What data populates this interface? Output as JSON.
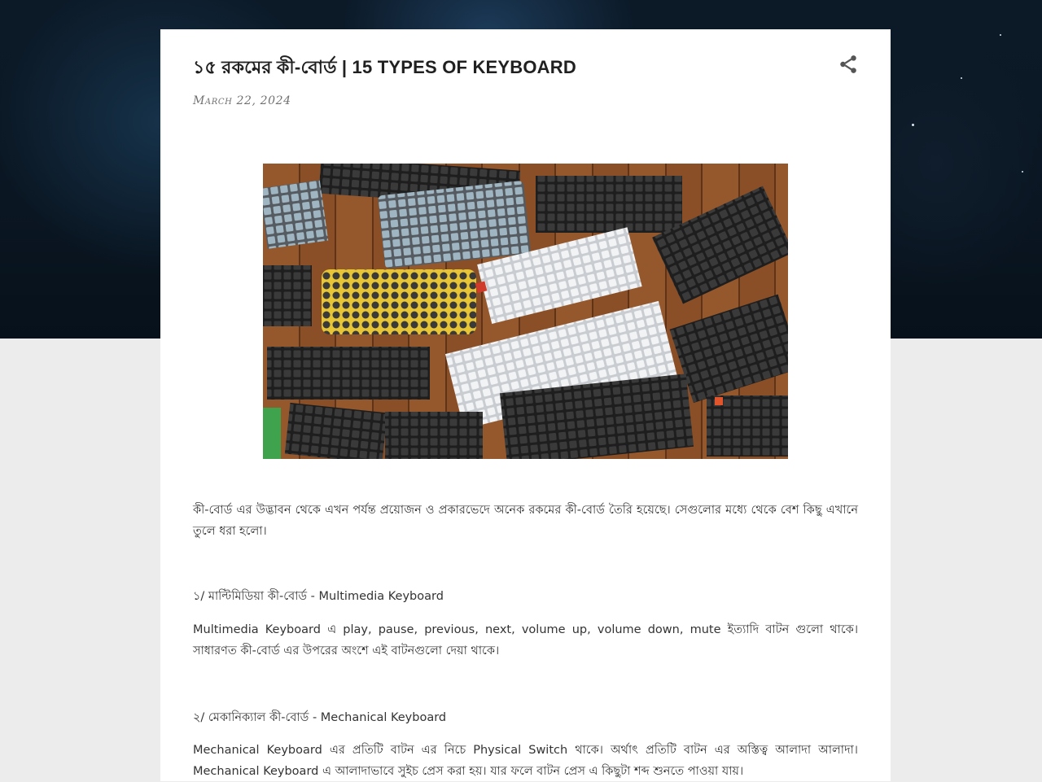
{
  "post": {
    "title": "১৫ রকমের কী-বোর্ড | 15 TYPES OF KEYBOARD",
    "date": "March 22, 2024",
    "share_icon": "share-icon",
    "image_alt": "keyboards"
  },
  "content": {
    "intro": "কী-বোর্ড এর উদ্ভাবন থেকে এখন পর্যন্ত প্রয়োজন ও প্রকারভেদে অনেক রকমের কী-বোর্ড তৈরি হয়েছে। সেগুলোর মধ্যে থেকে বেশ কিছু এখানে তুলে ধরা হলো।",
    "sections": [
      {
        "heading": "১/ মাল্টিমিডিয়া কী-বোর্ড - Multimedia Keyboard",
        "text": "Multimedia Keyboard এ play, pause, previous, next, volume up, volume down, mute ইত্যাদি বাটন গুলো থাকে। সাধারণত কী-বোর্ড এর উপরের অংশে এই বাটনগুলো দেয়া থাকে।"
      },
      {
        "heading": "২/ মেকানিক্যাল কী-বোর্ড - Mechanical Keyboard",
        "text": "Mechanical Keyboard এর প্রতিটি বাটন এর নিচে Physical Switch থাকে। অর্থাৎ প্রতিটি বাটন এর অস্তিত্ব আলাদা আলাদা। Mechanical Keyboard এ আলাদাভাবে সুইচ প্রেস করা হয়। যার ফলে বাটন প্রেস এ কিছুটা শব্দ শুনতে পাওয়া যায়।"
      }
    ]
  },
  "colors": {
    "accent_red": "#d03a2a",
    "title_text": "#202020",
    "body_text": "#333333"
  }
}
